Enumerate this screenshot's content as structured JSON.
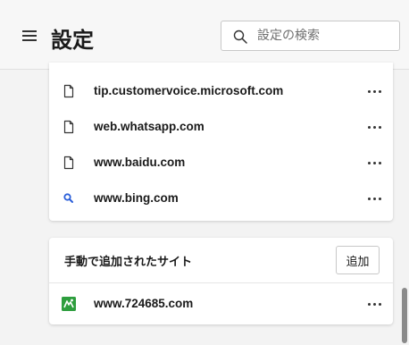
{
  "header": {
    "title": "設定",
    "search_placeholder": "設定の検索",
    "search_value": ""
  },
  "sites": [
    {
      "url": "tip.customervoice.microsoft.com",
      "icon": "page-icon"
    },
    {
      "url": "web.whatsapp.com",
      "icon": "page-icon"
    },
    {
      "url": "www.baidu.com",
      "icon": "page-icon"
    },
    {
      "url": "www.bing.com",
      "icon": "bing-search-icon"
    }
  ],
  "manual_section": {
    "title": "手動で追加されたサイト",
    "add_label": "追加",
    "items": [
      {
        "url": "www.724685.com",
        "icon": "green-site-icon"
      }
    ]
  },
  "colors": {
    "accent_blue": "#2b5fd9",
    "site_icon_green": "#2e9e3e"
  }
}
